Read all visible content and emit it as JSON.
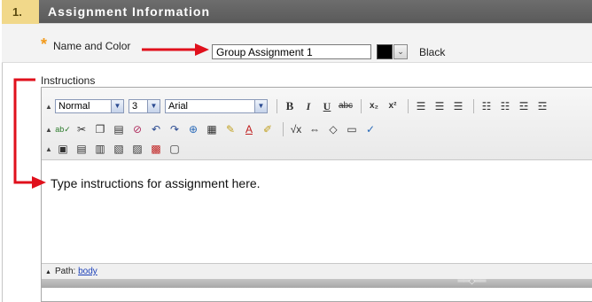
{
  "section": {
    "number": "1.",
    "title": "Assignment Information"
  },
  "name_field": {
    "required_marker": "*",
    "label": "Name and Color",
    "value": "Group Assignment 1"
  },
  "color": {
    "swatch": "#000000",
    "name": "Black"
  },
  "instructions": {
    "label": "Instructions",
    "content": "Type instructions for assignment here."
  },
  "toolbar": {
    "format_select": "Normal",
    "size_select": "3",
    "font_select": "Arial",
    "bold": "B",
    "italic": "I",
    "underline": "U",
    "strike": "abc",
    "subscript": "x₂",
    "superscript": "x²"
  },
  "path_bar": {
    "label": "Path:",
    "link": "body"
  },
  "colors": {
    "header_bg": "#5f5f5f",
    "step_bg": "#f1d88a",
    "required": "#f29a1b",
    "annotation_arrow": "#e0101c",
    "link": "#1a3fb8"
  }
}
